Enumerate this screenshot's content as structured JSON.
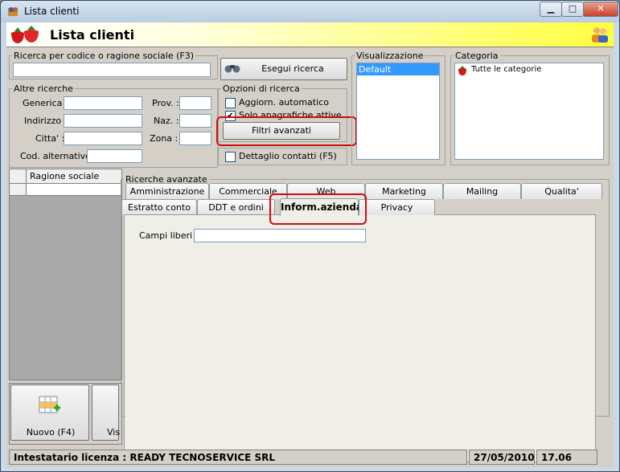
{
  "window": {
    "title": "Lista clienti",
    "buttons": {
      "minimize": "▁",
      "maximize": "□",
      "close": "✕"
    }
  },
  "header": {
    "title": "Lista clienti"
  },
  "search": {
    "legend": "Ricerca per codice o ragione sociale (F3)",
    "value": "",
    "button": "Esegui ricerca"
  },
  "altre": {
    "legend": "Altre ricerche",
    "generica": "Generica :",
    "indirizzo": "Indirizzo :",
    "citta": "Citta' :",
    "cod_alt": "Cod. alternativo :",
    "prov": "Prov. :",
    "naz": "Naz. :",
    "zona": "Zona :"
  },
  "opzioni": {
    "legend": "Opzioni di ricerca",
    "aggiorn": "Aggiorn. automatico",
    "solo": "Solo anagrafiche attive",
    "filtri": "Filtri avanzati",
    "dettaglio": "Dettaglio contatti (F5)"
  },
  "visual": {
    "legend": "Visualizzazione",
    "items": [
      "Default"
    ]
  },
  "categoria": {
    "legend": "Categoria",
    "items": [
      "Tutte le categorie"
    ]
  },
  "grid": {
    "col": "Ragione sociale"
  },
  "advanced": {
    "legend": "Ricerche avanzate",
    "tabs_back": [
      "Amministrazione",
      "Commerciale",
      "Web",
      "Marketing",
      "Mailing",
      "Qualita'"
    ],
    "tabs_front": [
      "Estratto conto",
      "DDT e ordini",
      "Inform.azienda",
      "Privacy"
    ],
    "campi_label": "Campi liberi :",
    "campi_value": ""
  },
  "bottom": {
    "nuovo": "Nuovo (F4)",
    "vis": "Vis"
  },
  "status": {
    "license": "Intestatario licenza : READY TECNOSERVICE SRL",
    "date": "27/05/2010",
    "time": "17.06"
  },
  "colors": {
    "highlight": "#3399ff",
    "annotation": "#d10a0a"
  }
}
